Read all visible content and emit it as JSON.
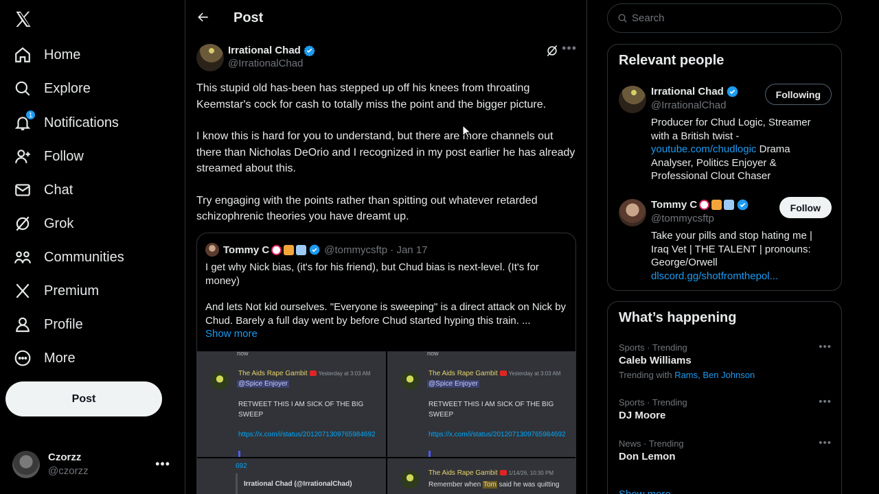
{
  "nav": {
    "items": [
      {
        "label": "Home",
        "icon": "home-icon"
      },
      {
        "label": "Explore",
        "icon": "search-icon"
      },
      {
        "label": "Notifications",
        "icon": "bell-icon",
        "badge": "1"
      },
      {
        "label": "Follow",
        "icon": "add-person-icon"
      },
      {
        "label": "Chat",
        "icon": "envelope-icon"
      },
      {
        "label": "Grok",
        "icon": "grok-icon"
      },
      {
        "label": "Communities",
        "icon": "communities-icon"
      },
      {
        "label": "Premium",
        "icon": "x-logo-icon"
      },
      {
        "label": "Profile",
        "icon": "person-icon"
      },
      {
        "label": "More",
        "icon": "more-circle-icon"
      }
    ],
    "post_label": "Post",
    "account": {
      "display_name": "Czorzz",
      "handle": "@czorzz"
    }
  },
  "header": {
    "title": "Post"
  },
  "tweet": {
    "author": "Irrational Chad",
    "handle": "@IrrationalChad",
    "paragraphs": [
      "This stupid old has-been has stepped up off his knees from throating Keemstar's cock for cash to totally miss the point and the bigger picture.",
      "I know this is hard for you to understand, but there are more channels out there than Nicholas DeOrio and I recognized in my post earlier he has already streamed about this.",
      "Try engaging with the points rather than spitting out whatever retarded schizophrenic theories you have dreamt up."
    ],
    "quote": {
      "author": "Tommy C",
      "meta": "@tommycsftp · Jan 17",
      "paragraphs": [
        "I get why Nick bias, (it's for his friend), but Chud bias is next-level.  (It's for money)",
        "And lets Not kid ourselves.  \"Everyone is sweeping\" is a direct attack on Nick by Chud.  Barely a full day went by before Chud started hyping this train. ..."
      ],
      "show_more": "Show more",
      "media": {
        "top_fragment": "now",
        "sender": "The Aids Rape Gambit",
        "time": "Yesterday at 3:03 AM",
        "mention": "@Spice Enjoyer",
        "message": "RETWEET THIS I AM SICK OF THE BIG SWEEP",
        "link": "https://x.com/i/status/2012071309765984692",
        "link_tail": "692",
        "quoted_name": "Irrational Chad (@IrrationalChad)",
        "time2": "1/14/26, 10:30 PM",
        "message2_pre": "Remember when ",
        "message2_hl": "Tom",
        "message2_post": " said he was quitting"
      }
    }
  },
  "search": {
    "placeholder": "Search"
  },
  "relevant": {
    "title": "Relevant people",
    "people": [
      {
        "name": "Irrational Chad",
        "handle": "@IrrationalChad",
        "button": "Following",
        "bio_pre": "Producer for Chud Logic, Streamer with a British twist - ",
        "bio_link": "youtube.com/chudlogic",
        "bio_post": " Drama Analyser, Politics Enjoyer & Professional Clout Chaser"
      },
      {
        "name": "Tommy C",
        "handle": "@tommycsftp",
        "button": "Follow",
        "bio_pre": "Take your pills and stop hating me | Iraq Vet | THE TALENT | pronouns: George/Orwell",
        "bio_link": "dlscord.gg/shotfromthepol...",
        "bio_post": ""
      }
    ]
  },
  "happening": {
    "title": "What’s happening",
    "trends": [
      {
        "category": "Sports · Trending",
        "name": "Caleb Williams",
        "with_label": "Trending with",
        "with_links": "Rams, Ben Johnson"
      },
      {
        "category": "Sports · Trending",
        "name": "DJ Moore"
      },
      {
        "category": "News · Trending",
        "name": "Don Lemon"
      }
    ],
    "show_more": "Show more"
  },
  "colors": {
    "accent": "#1d9bf0",
    "background": "#000000",
    "border": "#2f3336",
    "muted": "#71767b"
  }
}
